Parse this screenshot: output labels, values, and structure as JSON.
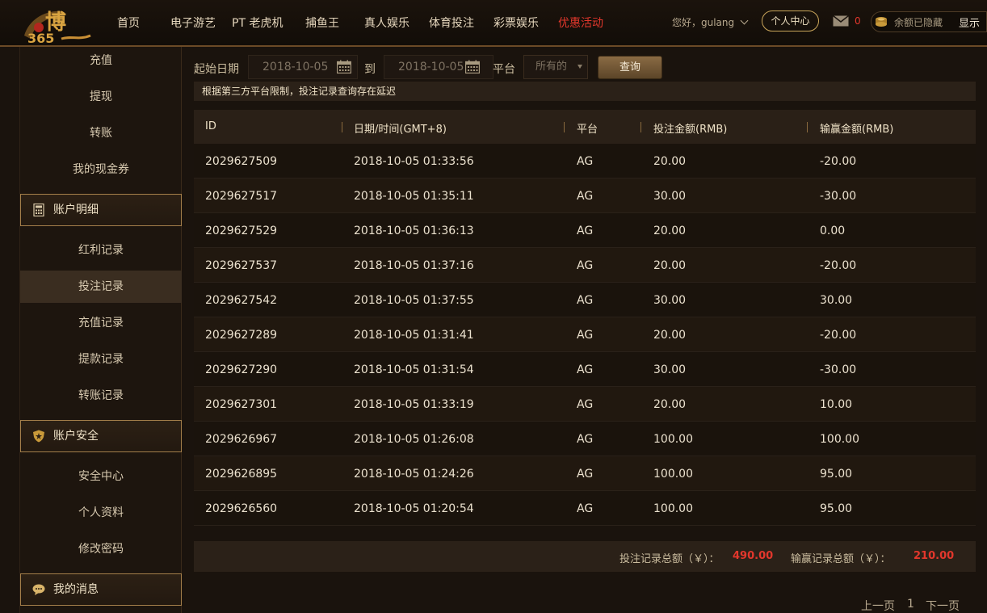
{
  "brand": {
    "logo_text": "博",
    "logo_sub": "365"
  },
  "nav": {
    "items": [
      {
        "label": "首页",
        "active": false
      },
      {
        "label": "电子游艺",
        "active": false
      },
      {
        "label": "PT 老虎机",
        "active": false
      },
      {
        "label": "捕鱼王",
        "active": false
      },
      {
        "label": "真人娱乐",
        "active": false
      },
      {
        "label": "体育投注",
        "active": false
      },
      {
        "label": "彩票娱乐",
        "active": false
      },
      {
        "label": "优惠活动",
        "active": true
      }
    ]
  },
  "user": {
    "greeting": "您好，gulang",
    "center_label": "个人中心",
    "mail_icon": "mail-icon",
    "mail_count": "0",
    "balance_text": "余额已隐藏",
    "show_label": "显示"
  },
  "sidebar": {
    "top_links": [
      "充值",
      "提现",
      "转账",
      "我的现金券"
    ],
    "section_account": "账户明细",
    "account_links": [
      "红利记录",
      "投注记录",
      "充值记录",
      "提款记录",
      "转账记录"
    ],
    "active_link": "投注记录",
    "section_security": "账户安全",
    "security_links": [
      "安全中心",
      "个人资料",
      "修改密码"
    ],
    "section_messages": "我的消息"
  },
  "filter": {
    "start_label": "起始日期",
    "start_value": "2018-10-05",
    "to_label": "到",
    "end_value": "2018-10-05",
    "platform_label": "平台",
    "platform_value": "所有的",
    "query_label": "查询"
  },
  "notice": "根据第三方平台限制，投注记录查询存在延迟",
  "table": {
    "headers": [
      "ID",
      "日期/时间(GMT+8)",
      "平台",
      "投注金额(RMB)",
      "输赢金额(RMB)"
    ],
    "rows": [
      [
        "2029627509",
        "2018-10-05 01:33:56",
        "AG",
        "20.00",
        "-20.00"
      ],
      [
        "2029627517",
        "2018-10-05 01:35:11",
        "AG",
        "30.00",
        "-30.00"
      ],
      [
        "2029627529",
        "2018-10-05 01:36:13",
        "AG",
        "20.00",
        "0.00"
      ],
      [
        "2029627537",
        "2018-10-05 01:37:16",
        "AG",
        "20.00",
        "-20.00"
      ],
      [
        "2029627542",
        "2018-10-05 01:37:55",
        "AG",
        "30.00",
        "30.00"
      ],
      [
        "2029627289",
        "2018-10-05 01:31:41",
        "AG",
        "20.00",
        "-20.00"
      ],
      [
        "2029627290",
        "2018-10-05 01:31:54",
        "AG",
        "30.00",
        "-30.00"
      ],
      [
        "2029627301",
        "2018-10-05 01:33:19",
        "AG",
        "20.00",
        "10.00"
      ],
      [
        "2029626967",
        "2018-10-05 01:26:08",
        "AG",
        "100.00",
        "100.00"
      ],
      [
        "2029626895",
        "2018-10-05 01:24:26",
        "AG",
        "100.00",
        "95.00"
      ],
      [
        "2029626560",
        "2018-10-05 01:20:54",
        "AG",
        "100.00",
        "95.00"
      ]
    ]
  },
  "totals": {
    "bet_label": "投注记录总额（￥）：",
    "bet_value": "490.00",
    "win_label": "输赢记录总额（￥）：",
    "win_value": "210.00"
  },
  "pager": {
    "prev": "上一页",
    "page": "1",
    "next": "下一页"
  }
}
